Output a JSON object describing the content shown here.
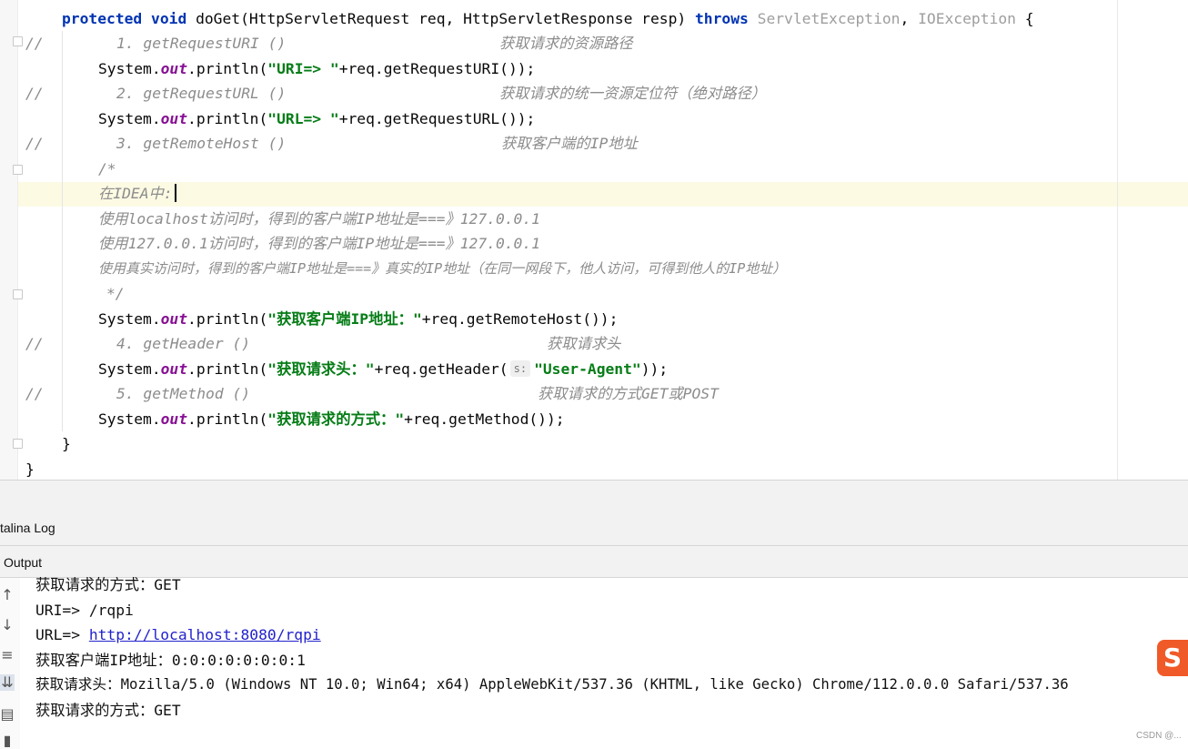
{
  "editor": {
    "method": {
      "protected": "protected",
      "void": "void",
      "sig": " doGet(HttpServletRequest req, HttpServletResponse resp) ",
      "throws": "throws",
      "ex1": "ServletException",
      "comma": ", ",
      "ex2": "IOException",
      "brace": " {"
    },
    "c1": {
      "slashes": "//",
      "text": "1. getRequestURI ()",
      "desc": "获取请求的资源路径"
    },
    "p1": {
      "pre": "System.",
      "out": "out",
      "mid": ".println(",
      "str": "\"URI=> \"",
      "post": "+req.getRequestURI());"
    },
    "c2": {
      "slashes": "//",
      "text": "2. getRequestURL ()",
      "desc": "获取请求的统一资源定位符（绝对路径）"
    },
    "p2": {
      "pre": "System.",
      "out": "out",
      "mid": ".println(",
      "str": "\"URL=> \"",
      "post": "+req.getRequestURL());"
    },
    "c3": {
      "slashes": "//",
      "text": "3. getRemoteHost ()",
      "desc": "获取客户端的IP地址"
    },
    "block": {
      "open": "/*",
      "l1": "在IDEA中:",
      "l2": "使用localhost访问时，得到的客户端IP地址是===》127.0.0.1",
      "l3": "使用127.0.0.1访问时，得到的客户端IP地址是===》127.0.0.1",
      "l4": "使用真实访问时，得到的客户端IP地址是===》真实的IP地址（在同一网段下，他人访问，可得到他人的IP地址）",
      "close": "*/"
    },
    "p3": {
      "pre": "System.",
      "out": "out",
      "mid": ".println(",
      "str": "\"获取客户端IP地址：\"",
      "post": "+req.getRemoteHost());"
    },
    "c4": {
      "slashes": "//",
      "text": "4. getHeader ()",
      "desc": "获取请求头"
    },
    "p4": {
      "pre": "System.",
      "out": "out",
      "mid": ".println(",
      "str1": "\"获取请求头：\"",
      "call": "+req.getHeader(",
      "hint": "s:",
      "str2": "\"User-Agent\"",
      "post": "));"
    },
    "c5": {
      "slashes": "//",
      "text": "5. getMethod ()",
      "desc": "获取请求的方式GET或POST"
    },
    "p5": {
      "pre": "System.",
      "out": "out",
      "mid": ".println(",
      "str": "\"获取请求的方式：\"",
      "post": "+req.getMethod());"
    },
    "close_method": "}",
    "close_class": "}"
  },
  "panel": {
    "tab_catalina": "talina Log",
    "output_label": "Output",
    "toolbar_icons": [
      "arrow-up-icon",
      "arrow-down-icon",
      "soft-wrap-icon",
      "scroll-to-end-icon",
      "print-icon",
      "trash-icon"
    ],
    "lines": {
      "l1": "获取请求的方式：GET",
      "l2": "URI=> /rqpi",
      "l3_prefix": "URL=> ",
      "l3_link": "http://localhost:8080/rqpi",
      "l4": "获取客户端IP地址：0:0:0:0:0:0:0:1",
      "l5": "获取请求头：Mozilla/5.0 (Windows NT 10.0; Win64; x64) AppleWebKit/537.36 (KHTML, like Gecko) Chrome/112.0.0.0 Safari/537.36",
      "l6": "获取请求的方式：GET"
    }
  },
  "overlay": {
    "logo_glyph": "S",
    "watermark": "CSDN @..."
  },
  "colors": {
    "keyword": "#0033b3",
    "string": "#067d17",
    "field": "#871094",
    "comment": "#8c8c8c",
    "current_line": "#fcfae3",
    "link": "#2222cc",
    "logo": "#f05a28"
  }
}
